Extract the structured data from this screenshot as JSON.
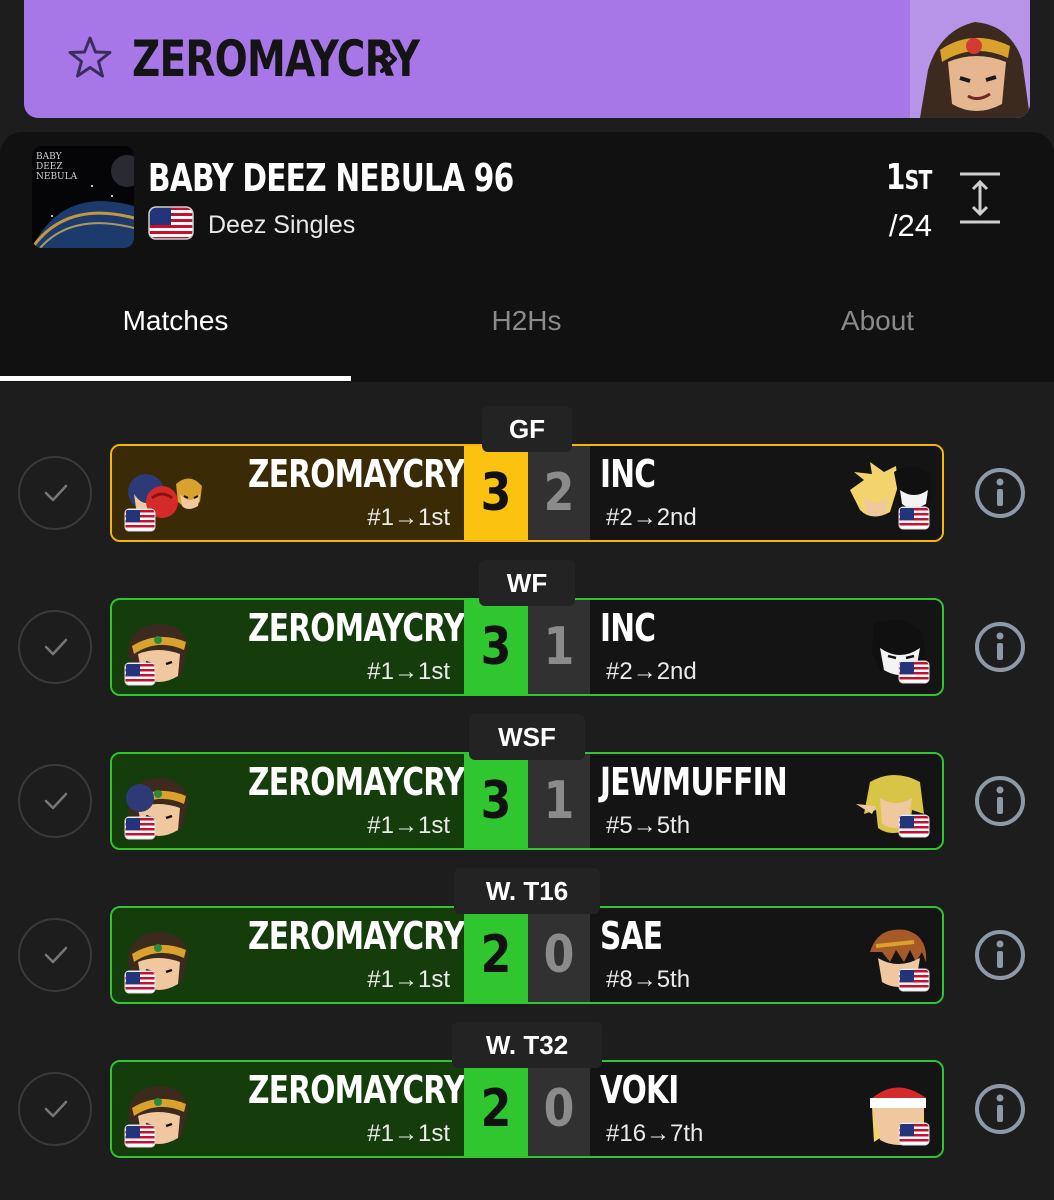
{
  "player": {
    "name": "ZEROMAYCRY",
    "favorite_icon": "star-outline-icon",
    "chevron_icon": "chevron-right-icon",
    "avatar_icon": "character-avatar-icon"
  },
  "tournament": {
    "name": "BABY DEEZ NEBULA 96",
    "thumb_text": "BABY DEEZ NEBULA",
    "event": "Deez Singles",
    "country_flag": "us-flag-icon",
    "placement": "1",
    "placement_suffix": "ST",
    "entrants": "/24"
  },
  "tabs": [
    {
      "label": "Matches",
      "active": true
    },
    {
      "label": "H2Hs",
      "active": false
    },
    {
      "label": "About",
      "active": false
    }
  ],
  "colors": {
    "banner": "#a777e8",
    "win_green": "#2fc62f",
    "win_gold": "#fcc210",
    "background": "#1d1d1d"
  },
  "matches": [
    {
      "round": "GF",
      "player": "ZEROMAYCRY",
      "player_seed": "#1→1st",
      "player_score": "3",
      "opponent": "INC",
      "opponent_seed": "#2→2nd",
      "opponent_score": "2",
      "style": "gold"
    },
    {
      "round": "WF",
      "player": "ZEROMAYCRY",
      "player_seed": "#1→1st",
      "player_score": "3",
      "opponent": "INC",
      "opponent_seed": "#2→2nd",
      "opponent_score": "1",
      "style": "green"
    },
    {
      "round": "WSF",
      "player": "ZEROMAYCRY",
      "player_seed": "#1→1st",
      "player_score": "3",
      "opponent": "JEWMUFFIN",
      "opponent_seed": "#5→5th",
      "opponent_score": "1",
      "style": "green"
    },
    {
      "round": "W. T16",
      "player": "ZEROMAYCRY",
      "player_seed": "#1→1st",
      "player_score": "2",
      "opponent": "SAE",
      "opponent_seed": "#8→5th",
      "opponent_score": "0",
      "style": "green"
    },
    {
      "round": "W. T32",
      "player": "ZEROMAYCRY",
      "player_seed": "#1→1st",
      "player_score": "2",
      "opponent": "VOKI",
      "opponent_seed": "#16→7th",
      "opponent_score": "0",
      "style": "green"
    }
  ]
}
